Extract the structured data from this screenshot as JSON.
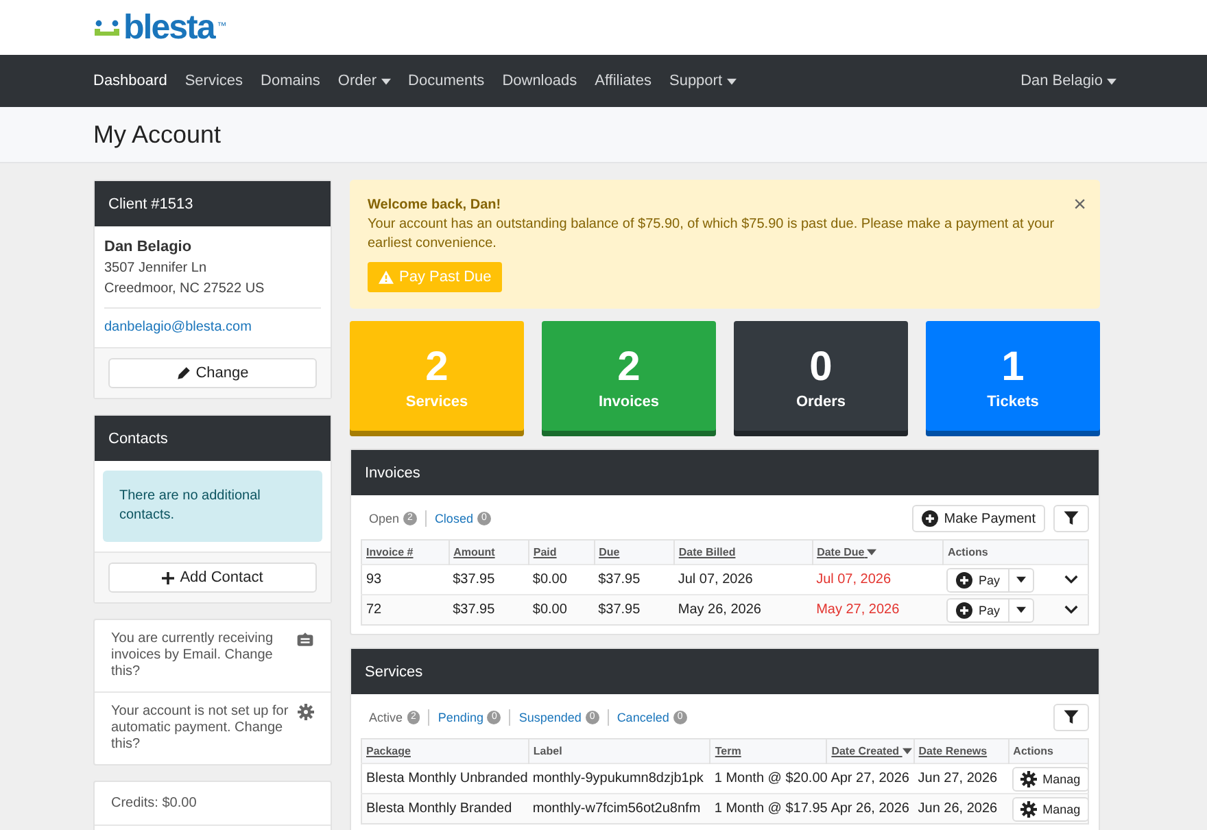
{
  "logo": {
    "text": "blesta",
    "mark": "™"
  },
  "nav": {
    "items": [
      {
        "label": "Dashboard",
        "selected": true,
        "dropdown": false
      },
      {
        "label": "Services",
        "selected": false,
        "dropdown": false
      },
      {
        "label": "Domains",
        "selected": false,
        "dropdown": false
      },
      {
        "label": "Order",
        "selected": false,
        "dropdown": true
      },
      {
        "label": "Documents",
        "selected": false,
        "dropdown": false
      },
      {
        "label": "Downloads",
        "selected": false,
        "dropdown": false
      },
      {
        "label": "Affiliates",
        "selected": false,
        "dropdown": false
      },
      {
        "label": "Support",
        "selected": false,
        "dropdown": true
      }
    ],
    "user": {
      "label": "Dan Belagio",
      "dropdown": true
    }
  },
  "page_title": "My Account",
  "client_card": {
    "title": "Client #1513",
    "name": "Dan Belagio",
    "address_lines": [
      "3507 Jennifer Ln",
      "Creedmoor, NC 27522 US"
    ],
    "email": "danbelagio@blesta.com",
    "button": "Change"
  },
  "contacts_card": {
    "title": "Contacts",
    "message": "There are no additional contacts.",
    "button": "Add Contact"
  },
  "settings": [
    {
      "kind": "email",
      "text": "You are currently receiving invoices by Email. Change this?"
    },
    {
      "kind": "autopay",
      "text": "Your account is not set up for automatic payment. Change this?"
    }
  ],
  "credits": "Credits: $0.00",
  "alert": {
    "title": "Welcome back, Dan!",
    "message": "Your account has an outstanding balance of $75.90, of which $75.90 is past due. Please make a payment at your earliest convenience.",
    "button": "Pay Past Due",
    "close": "×"
  },
  "stats": [
    {
      "count": "2",
      "label": "Services",
      "color": "#ffc107"
    },
    {
      "count": "2",
      "label": "Invoices",
      "color": "#28a745"
    },
    {
      "count": "0",
      "label": "Orders",
      "color": "#343a40"
    },
    {
      "count": "1",
      "label": "Tickets",
      "color": "#007bff"
    }
  ],
  "invoices": {
    "title": "Invoices",
    "filters": [
      {
        "label": "Open",
        "count": "2",
        "selected": true
      },
      {
        "label": "Closed",
        "count": "0",
        "selected": false
      }
    ],
    "make_payment": "Make Payment",
    "columns": [
      {
        "label": "Invoice #",
        "sortable": true,
        "sorted": false
      },
      {
        "label": "Amount",
        "sortable": true,
        "sorted": false
      },
      {
        "label": "Paid",
        "sortable": true,
        "sorted": false
      },
      {
        "label": "Due",
        "sortable": true,
        "sorted": false
      },
      {
        "label": "Date Billed",
        "sortable": true,
        "sorted": false
      },
      {
        "label": "Date Due",
        "sortable": true,
        "sorted": true
      },
      {
        "label": "Actions",
        "sortable": false,
        "sorted": false
      }
    ],
    "rows": [
      {
        "cells": [
          "93",
          "$37.95",
          "$0.00",
          "$37.95",
          "Jul 07, 2026",
          "Jul 07, 2026"
        ],
        "overdue": true,
        "action": "Pay"
      },
      {
        "cells": [
          "72",
          "$37.95",
          "$0.00",
          "$37.95",
          "May 26, 2026",
          "May 27, 2026"
        ],
        "overdue": true,
        "action": "Pay"
      }
    ]
  },
  "services": {
    "title": "Services",
    "filters": [
      {
        "label": "Active",
        "count": "2",
        "selected": true
      },
      {
        "label": "Pending",
        "count": "0",
        "selected": false
      },
      {
        "label": "Suspended",
        "count": "0",
        "selected": false
      },
      {
        "label": "Canceled",
        "count": "0",
        "selected": false
      }
    ],
    "columns": [
      {
        "label": "Package",
        "sortable": true,
        "sorted": false
      },
      {
        "label": "Label",
        "sortable": false,
        "sorted": false
      },
      {
        "label": "Term",
        "sortable": true,
        "sorted": false
      },
      {
        "label": "Date Created",
        "sortable": true,
        "sorted": true
      },
      {
        "label": "Date Renews",
        "sortable": true,
        "sorted": false
      },
      {
        "label": "Actions",
        "sortable": false,
        "sorted": false
      }
    ],
    "rows": [
      {
        "cells": [
          "Blesta Monthly Unbranded",
          "monthly-9ypukumn8dzjb1pk",
          "1 Month @ $20.00",
          "Apr 27, 2026",
          "Jun 27, 2026"
        ],
        "action": "Manag"
      },
      {
        "cells": [
          "Blesta Monthly Branded",
          "monthly-w7fcim56ot2u8nfm",
          "1 Month @ $17.95",
          "Apr 26, 2026",
          "Jun 26, 2026"
        ],
        "action": "Manag"
      }
    ]
  }
}
